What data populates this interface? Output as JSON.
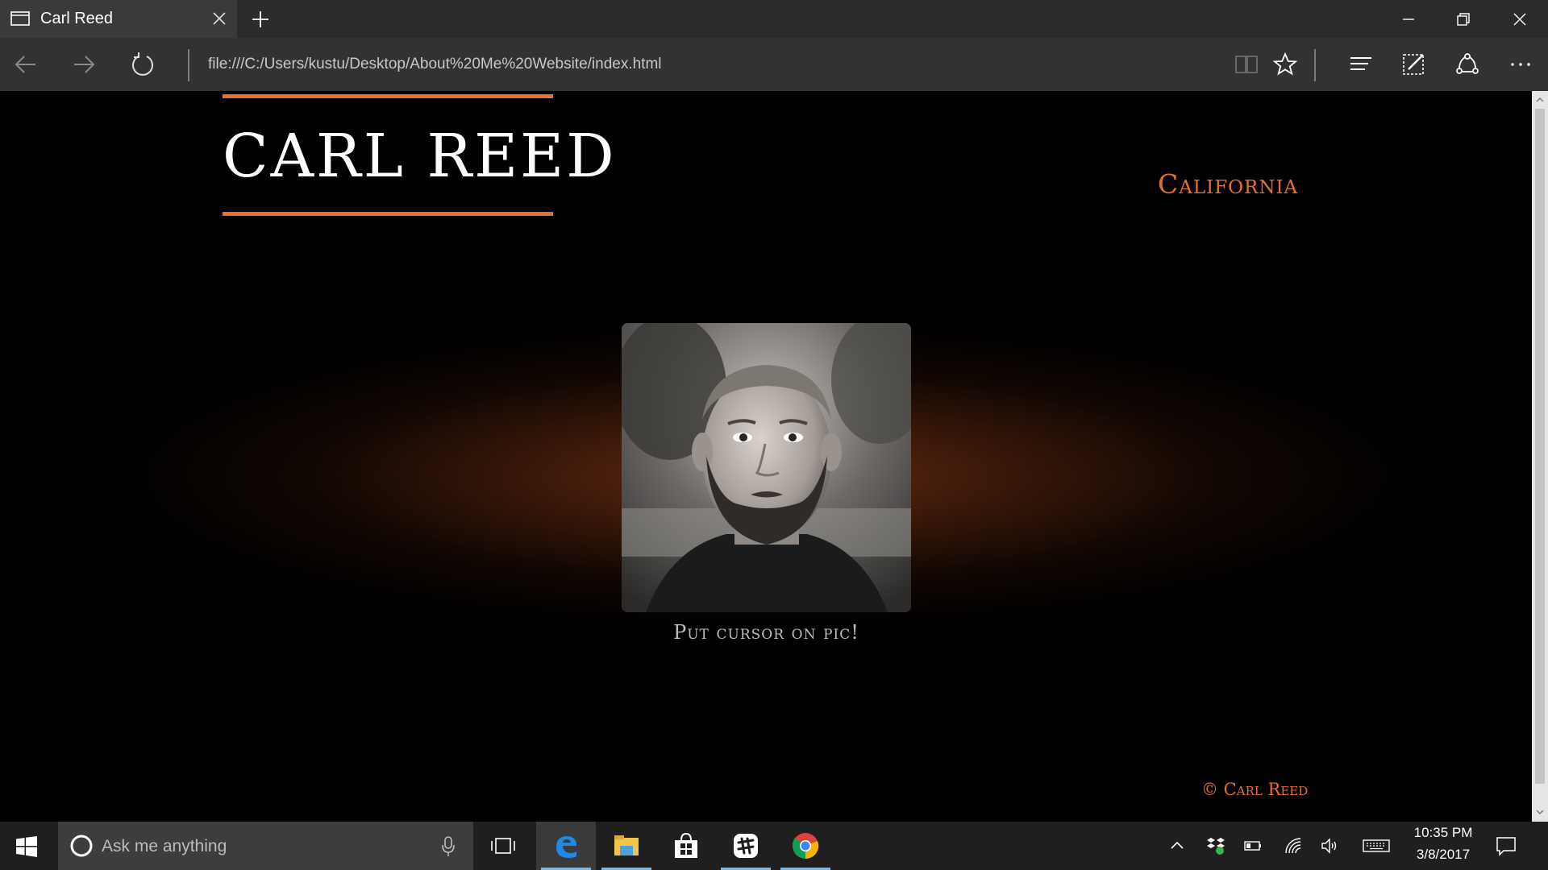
{
  "browser": {
    "tab_title": "Carl Reed",
    "url": "file:///C:/Users/kustu/Desktop/About%20Me%20Website/index.html"
  },
  "page": {
    "site_title": "CARL REED",
    "location": "California",
    "photo_alt": "Portrait photo",
    "caption": "Put cursor on pic!",
    "copyright": "© Carl Reed",
    "accent_color": "#e8702e"
  },
  "taskbar": {
    "search_placeholder": "Ask me anything",
    "time": "10:35 PM",
    "date": "3/8/2017",
    "apps": [
      "edge-icon",
      "file-explorer-icon",
      "store-icon",
      "slack-icon",
      "chrome-icon"
    ]
  }
}
